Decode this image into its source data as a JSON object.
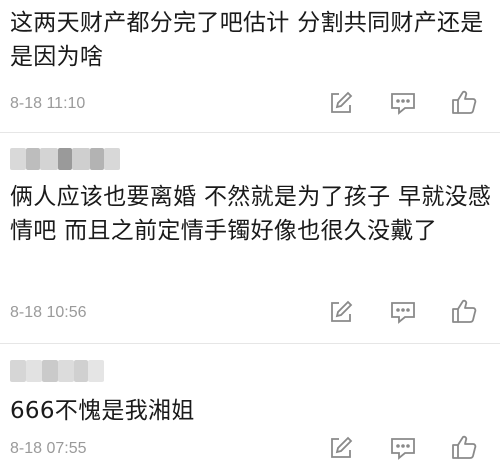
{
  "comments": [
    {
      "text": "这两天财产都分完了吧估计 分割共同财产还是是因为啥",
      "time": "8-18 11:10",
      "username_blurred": false
    },
    {
      "text": "俩人应该也要离婚 不然就是为了孩子 早就没感情吧 而且之前定情手镯好像也很久没戴了",
      "time": "8-18 10:56",
      "username_blurred": true
    },
    {
      "text": "666不愧是我湘姐",
      "time": "8-18 07:55",
      "username_blurred": true
    }
  ],
  "icons": {
    "edit": "edit-icon",
    "reply": "comment-icon",
    "like": "thumbs-up-icon"
  },
  "colors": {
    "icon": "#8a8a8a",
    "meta": "#9a9a9a",
    "text": "#1a1a1a",
    "divider": "#e6e6e6"
  }
}
